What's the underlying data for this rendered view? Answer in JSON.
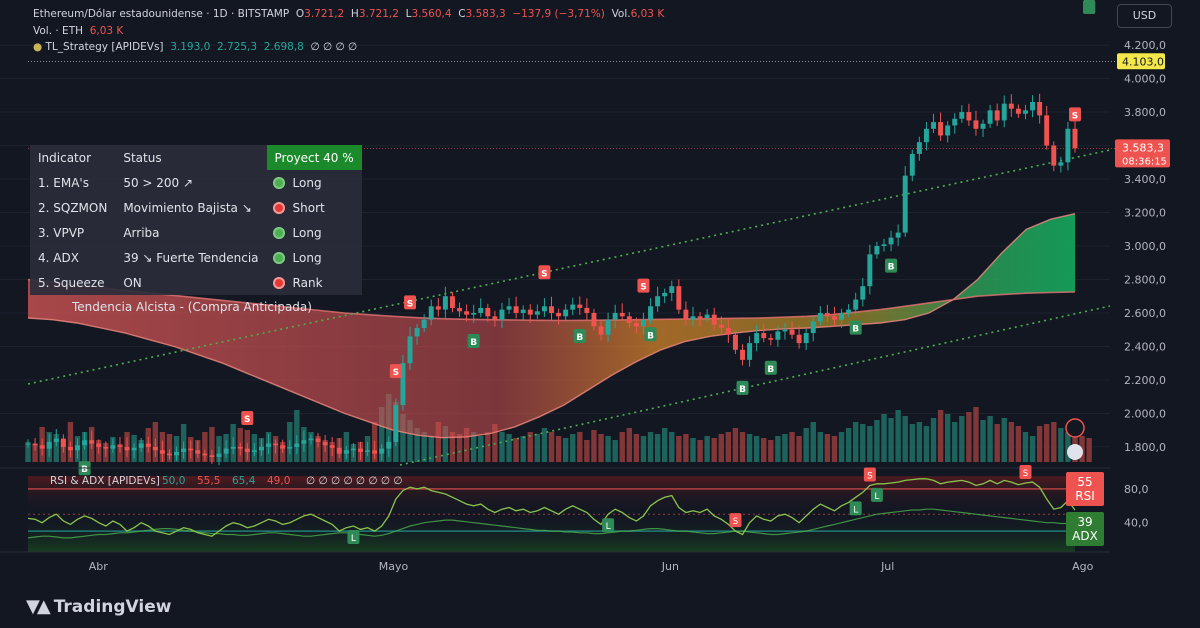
{
  "header": {
    "line1_pair": "Ethereum/Dólar estadounidense · 1D · BITSTAMP",
    "o_label": "O",
    "o_value": "3.721,2",
    "h_label": "H",
    "h_value": "3.721,2",
    "l_label": "L",
    "l_value": "3.560,4",
    "c_label": "C",
    "c_value": "3.583,3",
    "change": "−137,9 (−3,71%)",
    "vol_label": "Vol.",
    "vol_value": "6,03 K",
    "line2_label": "Vol. · ETH",
    "line2_value": "6,03 K",
    "line3_label": "TL_Strategy [APIDEVs]",
    "line3_v1": "3.193,0",
    "line3_v2": "2.725,3",
    "line3_v3": "2.698,8",
    "line3_tail": "∅ ∅ ∅ ∅"
  },
  "currency_button": "USD",
  "indicator_table": {
    "head": [
      "Indicator",
      "Status",
      "Proyect 40 %"
    ],
    "rows": [
      {
        "name": "1. EMA's",
        "status": "50 > 200 ↗",
        "signal": "Long",
        "color": "#4caf50"
      },
      {
        "name": "2. SQZMON",
        "status": "Movimiento Bajista ↘",
        "signal": "Short",
        "color": "#e53935"
      },
      {
        "name": "3. VPVP",
        "status": "Arriba",
        "signal": "Long",
        "color": "#4caf50"
      },
      {
        "name": "4. ADX",
        "status": "39 ↘ Fuerte Tendencia",
        "signal": "Long",
        "color": "#4caf50"
      },
      {
        "name": "5. Squeeze",
        "status": "ON",
        "signal": "Rank",
        "color": "#e53935"
      }
    ],
    "summary": "Tendencia Alcista - (Compra Anticipada)"
  },
  "chart_data": {
    "type": "candlestick",
    "x_ticks": [
      "Abr",
      "Mayo",
      "Jun",
      "Jul",
      "Ago"
    ],
    "y_ticks": [
      "4.200,0",
      "4.000,0",
      "3.800,0",
      "3.600,0",
      "3.400,0",
      "3.200,0",
      "3.000,0",
      "2.800,0",
      "2.600,0",
      "2.400,0",
      "2.200,0",
      "2.000,0",
      "1.800,0"
    ],
    "y_tick_values": [
      4200,
      4000,
      3800,
      3600,
      3400,
      3200,
      3000,
      2800,
      2600,
      2400,
      2200,
      2000,
      1800
    ],
    "ylim": [
      1710,
      4290
    ],
    "price_label": "3.583,3",
    "price_value": 3583.3,
    "countdown": "08:36:15",
    "high_label": "4.103,0",
    "high_value": 4103,
    "closes": [
      1820,
      1810,
      1790,
      1830,
      1850,
      1800,
      1780,
      1810,
      1840,
      1820,
      1800,
      1790,
      1810,
      1800,
      1780,
      1795,
      1820,
      1800,
      1780,
      1760,
      1750,
      1770,
      1790,
      1780,
      1760,
      1750,
      1740,
      1760,
      1790,
      1800,
      1790,
      1770,
      1780,
      1800,
      1820,
      1810,
      1790,
      1800,
      1820,
      1840,
      1850,
      1830,
      1810,
      1795,
      1760,
      1780,
      1790,
      1770,
      1780,
      1760,
      1790,
      1830,
      2050,
      2300,
      2460,
      2510,
      2560,
      2640,
      2620,
      2700,
      2630,
      2610,
      2590,
      2600,
      2630,
      2580,
      2560,
      2620,
      2640,
      2600,
      2620,
      2590,
      2610,
      2640,
      2600,
      2580,
      2620,
      2650,
      2630,
      2600,
      2520,
      2470,
      2560,
      2600,
      2580,
      2540,
      2520,
      2560,
      2640,
      2700,
      2720,
      2760,
      2620,
      2560,
      2580,
      2570,
      2590,
      2530,
      2510,
      2470,
      2380,
      2320,
      2420,
      2480,
      2450,
      2440,
      2490,
      2500,
      2470,
      2420,
      2480,
      2550,
      2600,
      2580,
      2560,
      2600,
      2620,
      2680,
      2760,
      2950,
      3000,
      3010,
      3050,
      3080,
      3420,
      3550,
      3620,
      3700,
      3740,
      3660,
      3720,
      3760,
      3800,
      3750,
      3700,
      3730,
      3810,
      3750,
      3850,
      3820,
      3790,
      3810,
      3860,
      3780,
      3600,
      3480,
      3500,
      3700,
      3583
    ],
    "volume_ylim": [
      0,
      100
    ],
    "volumes": [
      20,
      18,
      35,
      30,
      28,
      22,
      40,
      26,
      30,
      35,
      22,
      19,
      25,
      18,
      30,
      27,
      22,
      34,
      40,
      30,
      28,
      26,
      38,
      25,
      22,
      30,
      35,
      26,
      28,
      38,
      34,
      32,
      28,
      24,
      30,
      26,
      20,
      40,
      52,
      35,
      30,
      26,
      22,
      20,
      24,
      30,
      18,
      20,
      26,
      40,
      55,
      68,
      60,
      48,
      42,
      34,
      30,
      26,
      40,
      36,
      30,
      28,
      34,
      30,
      26,
      30,
      38,
      30,
      28,
      24,
      26,
      30,
      28,
      34,
      30,
      26,
      24,
      28,
      30,
      22,
      32,
      28,
      26,
      22,
      30,
      34,
      28,
      26,
      30,
      28,
      34,
      30,
      26,
      28,
      24,
      22,
      26,
      24,
      28,
      30,
      34,
      30,
      28,
      26,
      24,
      22,
      26,
      28,
      30,
      26,
      34,
      40,
      30,
      28,
      26,
      30,
      34,
      40,
      38,
      36,
      42,
      48,
      44,
      52,
      46,
      38,
      40,
      36,
      44,
      52,
      48,
      40,
      46,
      50,
      55,
      42,
      46,
      38,
      44,
      40,
      36,
      30,
      26,
      36,
      38,
      40,
      34,
      30,
      28,
      26,
      24
    ],
    "ema50": [
      2570,
      2560,
      2540,
      2510,
      2480,
      2440,
      2400,
      2350,
      2300,
      2240,
      2180,
      2120,
      2060,
      2000,
      1950,
      1900,
      1870,
      1855,
      1860,
      1880,
      1920,
      1980,
      2050,
      2140,
      2230,
      2310,
      2380,
      2430,
      2460,
      2480,
      2495,
      2505,
      2510,
      2520,
      2530,
      2540,
      2560,
      2600,
      2680,
      2800,
      2960,
      3100,
      3160,
      3193
    ],
    "ema200": [
      2800,
      2785,
      2770,
      2750,
      2735,
      2720,
      2705,
      2690,
      2675,
      2660,
      2645,
      2630,
      2615,
      2600,
      2590,
      2580,
      2572,
      2566,
      2562,
      2560,
      2558,
      2556,
      2555,
      2556,
      2558,
      2560,
      2562,
      2564,
      2566,
      2568,
      2570,
      2575,
      2580,
      2590,
      2605,
      2620,
      2640,
      2660,
      2680,
      2700,
      2710,
      2718,
      2722,
      2725
    ],
    "rsi_ticks": [
      "80,0",
      "40,0"
    ],
    "rsi_tick_values": [
      80,
      40
    ],
    "rsi_ylim": [
      10,
      100
    ],
    "rsi": [
      45,
      44,
      40,
      46,
      50,
      42,
      38,
      44,
      48,
      45,
      40,
      36,
      42,
      38,
      30,
      34,
      40,
      36,
      30,
      28,
      26,
      30,
      34,
      32,
      28,
      26,
      24,
      30,
      36,
      40,
      38,
      34,
      36,
      40,
      44,
      42,
      38,
      40,
      44,
      48,
      50,
      46,
      42,
      38,
      30,
      34,
      36,
      32,
      34,
      30,
      36,
      48,
      68,
      78,
      82,
      80,
      82,
      78,
      76,
      74,
      70,
      66,
      62,
      60,
      62,
      56,
      52,
      56,
      58,
      54,
      56,
      52,
      54,
      58,
      54,
      50,
      56,
      60,
      56,
      52,
      44,
      38,
      50,
      56,
      52,
      46,
      42,
      48,
      60,
      66,
      70,
      72,
      58,
      52,
      54,
      52,
      56,
      48,
      44,
      38,
      30,
      26,
      40,
      48,
      44,
      42,
      48,
      50,
      46,
      40,
      48,
      56,
      62,
      58,
      54,
      60,
      64,
      70,
      76,
      84,
      86,
      86,
      87,
      88,
      90,
      91,
      92,
      92,
      90,
      86,
      88,
      89,
      90,
      88,
      84,
      86,
      90,
      86,
      90,
      88,
      85,
      87,
      88,
      82,
      68,
      56,
      58,
      66,
      55
    ],
    "adx": [
      22,
      23,
      24,
      24,
      23,
      22,
      22,
      23,
      24,
      25,
      26,
      26,
      27,
      28,
      28,
      29,
      30,
      31,
      32,
      33,
      33,
      32,
      31,
      30,
      29,
      28,
      27,
      27,
      26,
      26,
      25,
      25,
      26,
      27,
      28,
      28,
      27,
      26,
      25,
      24,
      24,
      25,
      26,
      27,
      28,
      28,
      27,
      26,
      25,
      24,
      25,
      27,
      30,
      33,
      36,
      38,
      40,
      41,
      42,
      43,
      43,
      42,
      41,
      40,
      39,
      38,
      37,
      36,
      35,
      34,
      33,
      32,
      31,
      31,
      30,
      30,
      29,
      29,
      28,
      28,
      27,
      27,
      28,
      29,
      30,
      30,
      31,
      32,
      33,
      33,
      32,
      31,
      30,
      30,
      29,
      28,
      27,
      27,
      28,
      29,
      30,
      30,
      29,
      28,
      27,
      26,
      26,
      27,
      28,
      29,
      30,
      32,
      34,
      36,
      38,
      40,
      42,
      44,
      46,
      48,
      50,
      51,
      52,
      53,
      54,
      55,
      55,
      56,
      56,
      55,
      54,
      53,
      52,
      51,
      50,
      49,
      48,
      47,
      46,
      45,
      44,
      43,
      42,
      41,
      40,
      40,
      39,
      39,
      39,
      39,
      39
    ],
    "rsi_label_value": "55",
    "rsi_label_name": "RSI",
    "adx_label_value": "39",
    "adx_label_name": "ADX",
    "rsi_title": "RSI & ADX [APIDEVs]",
    "rsi_vals": [
      "50,0",
      "55,5",
      "65,4",
      "49,0"
    ],
    "rsi_tail": "∅ ∅ ∅ ∅ ∅ ∅ ∅ ∅",
    "buy_signals": [
      8,
      63,
      78,
      88,
      101,
      105,
      117,
      122
    ],
    "sell_signals": [
      31,
      52,
      54,
      73,
      87,
      148,
      150
    ],
    "rsi_long_signals": [
      46,
      82,
      117,
      120,
      150
    ],
    "rsi_short_signals": [
      100,
      119,
      141
    ]
  },
  "logo_text": "TradingView",
  "colors": {
    "up": "#26a69a",
    "down": "#ef5350",
    "background": "#131722"
  }
}
